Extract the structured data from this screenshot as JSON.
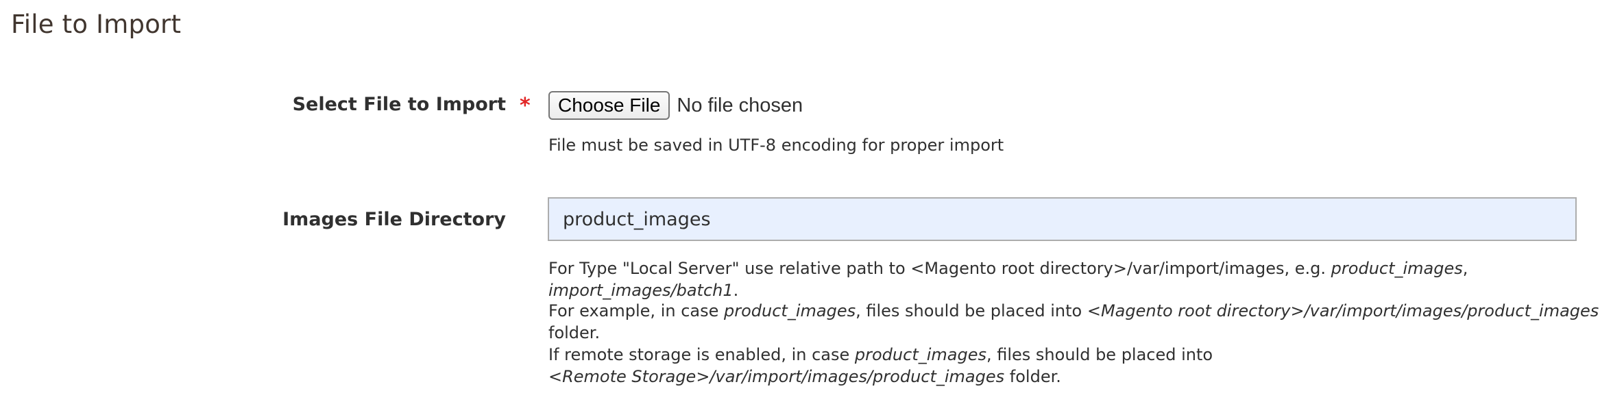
{
  "section": {
    "title": "File to Import"
  },
  "file_field": {
    "label": "Select File to Import",
    "required_marker": "*",
    "button_label": "Choose File",
    "status_text": "No file chosen",
    "note": "File must be saved in UTF-8 encoding for proper import"
  },
  "dir_field": {
    "label": "Images File Directory",
    "value": "product_images",
    "note1": {
      "text_a": "For Type \"Local Server\" use relative path to <Magento root directory>/var/import/images, e.g. ",
      "em_a": "product_images",
      "text_b": ", ",
      "em_b": "import_images/batch1",
      "text_c": "."
    },
    "note2": {
      "text_a": "For example, in case ",
      "em_a": "product_images",
      "text_b": ", files should be placed into ",
      "em_b": "<Magento root directory>/var/import/images/product_images",
      "text_c": " folder."
    },
    "note3": {
      "text_a": "If remote storage is enabled, in case ",
      "em_a": "product_images",
      "text_b": ", files should be placed into ",
      "em_b": "<Remote Storage>/var/import/images/product_images",
      "text_c": " folder."
    }
  },
  "colors": {
    "required": "#e22626",
    "input_autofill_bg": "#e8f0fe",
    "title": "#41362f"
  }
}
